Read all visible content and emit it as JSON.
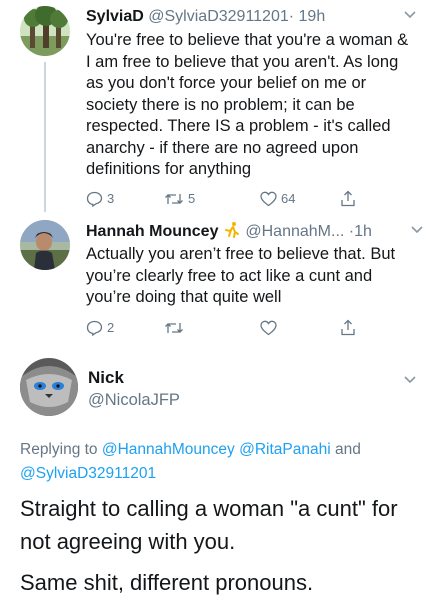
{
  "tweets": [
    {
      "name": "SylviaD",
      "handle": "@SylviaD32911201",
      "time": "· 19h",
      "text": "You're free to believe that you're a woman & I am free to believe that you aren't. As long as you don't force your belief on me or society there is no problem; it can be respected. There IS a problem - it's called anarchy - if there are no agreed upon definitions for anything",
      "replies": "3",
      "retweets": "5",
      "likes": "64"
    },
    {
      "name": "Hannah Mouncey",
      "handle": "@HannahM...",
      "time": "·1h",
      "text": "Actually you aren’t free to believe that. But you’re clearly free to act like a cunt and you’re doing that quite well",
      "replies": "2",
      "retweets": "",
      "likes": ""
    }
  ],
  "main": {
    "name": "Nick",
    "handle": "@NicolaJFP",
    "replying_label": "Replying to",
    "mentions": [
      "@HannahMouncey",
      "@RitaPanahi",
      "@SylviaD32911201"
    ],
    "and_word": "and",
    "text1": "Straight to calling a woman \"a cunt\" for not agreeing with you.",
    "text2": "Same shit, different pronouns."
  },
  "colors": {
    "link": "#1da1f2",
    "muted": "#657786",
    "thread_line": "#ccd6dd"
  },
  "icons": [
    "reply-icon",
    "retweet-icon",
    "like-icon",
    "share-icon",
    "chevron-down-icon",
    "runner-emoji-icon"
  ]
}
